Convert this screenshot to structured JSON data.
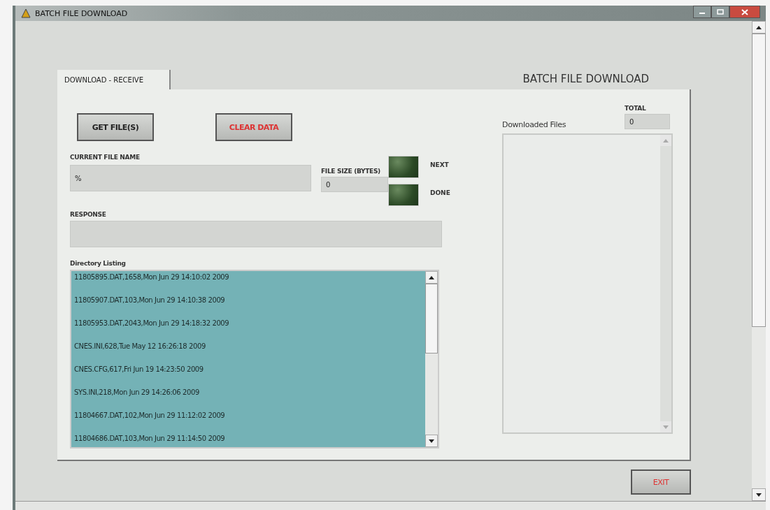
{
  "window": {
    "title": "BATCH FILE DOWNLOAD"
  },
  "tabs": [
    {
      "label": "DOWNLOAD - RECEIVE",
      "selected": true
    }
  ],
  "heading": "BATCH FILE DOWNLOAD",
  "buttons": {
    "get_files": "GET FILE(S)",
    "clear_data": "CLEAR DATA",
    "exit": "EXIT"
  },
  "current_file_name": {
    "label": "CURRENT FILE NAME",
    "value": "%"
  },
  "file_size": {
    "label": "FILE SIZE (BYTES)",
    "value": "0"
  },
  "indicators": [
    {
      "label": "NEXT",
      "on": false
    },
    {
      "label": "DONE",
      "on": false
    }
  ],
  "response": {
    "label": "RESPONSE"
  },
  "directory_listing": {
    "label": "Directory Listing",
    "items": [
      "11805895.DAT,1658,Mon Jun 29 14:10:02 2009",
      "11805907.DAT,103,Mon Jun 29 14:10:38 2009",
      "11805953.DAT,2043,Mon Jun 29 14:18:32 2009",
      "CNES.INI,628,Tue May 12 16:26:18 2009",
      "CNES.CFG,617,Fri Jun 19 14:23:50 2009",
      "SYS.INI,218,Mon Jun 29 14:26:06 2009",
      "11804667.DAT,102,Mon Jun 29 11:12:02 2009",
      "11804686.DAT,103,Mon Jun 29 11:14:50 2009"
    ]
  },
  "total": {
    "label": "TOTAL",
    "value": "0"
  },
  "downloaded_files": {
    "label": "Downloaded Files"
  }
}
